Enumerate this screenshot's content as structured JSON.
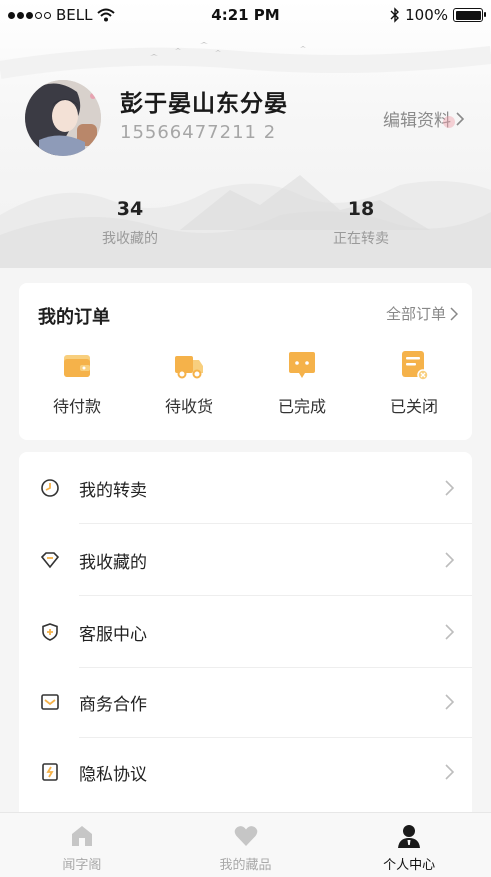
{
  "status_bar": {
    "carrier": "BELL",
    "time": "4:21 PM",
    "battery": "100%"
  },
  "profile": {
    "name": "彭于晏山东分晏",
    "phone": "15566477211 2",
    "edit_label": "编辑资料"
  },
  "stats": [
    {
      "value": "34",
      "label": "我收藏的"
    },
    {
      "value": "18",
      "label": "正在转卖"
    }
  ],
  "orders": {
    "title": "我的订单",
    "all_label": "全部订单",
    "items": [
      {
        "label": "待付款",
        "icon": "wallet-icon"
      },
      {
        "label": "待收货",
        "icon": "truck-icon"
      },
      {
        "label": "已完成",
        "icon": "chat-complete-icon"
      },
      {
        "label": "已关闭",
        "icon": "document-closed-icon"
      }
    ]
  },
  "menu": [
    {
      "label": "我的转卖",
      "icon": "clock-icon"
    },
    {
      "label": "我收藏的",
      "icon": "diamond-icon"
    },
    {
      "label": "客服中心",
      "icon": "shield-icon"
    },
    {
      "label": "商务合作",
      "icon": "mail-icon"
    },
    {
      "label": "隐私协议",
      "icon": "privacy-doc-icon"
    }
  ],
  "tabs": [
    {
      "label": "闻字阁",
      "icon": "home-icon",
      "active": false
    },
    {
      "label": "我的藏品",
      "icon": "heart-icon",
      "active": false
    },
    {
      "label": "个人中心",
      "icon": "person-icon",
      "active": true
    }
  ],
  "colors": {
    "accent_orange": "#f5b24a",
    "accent_orange_light": "#f8cf7e",
    "text_primary": "#222222",
    "text_secondary": "#9a9a9a"
  }
}
